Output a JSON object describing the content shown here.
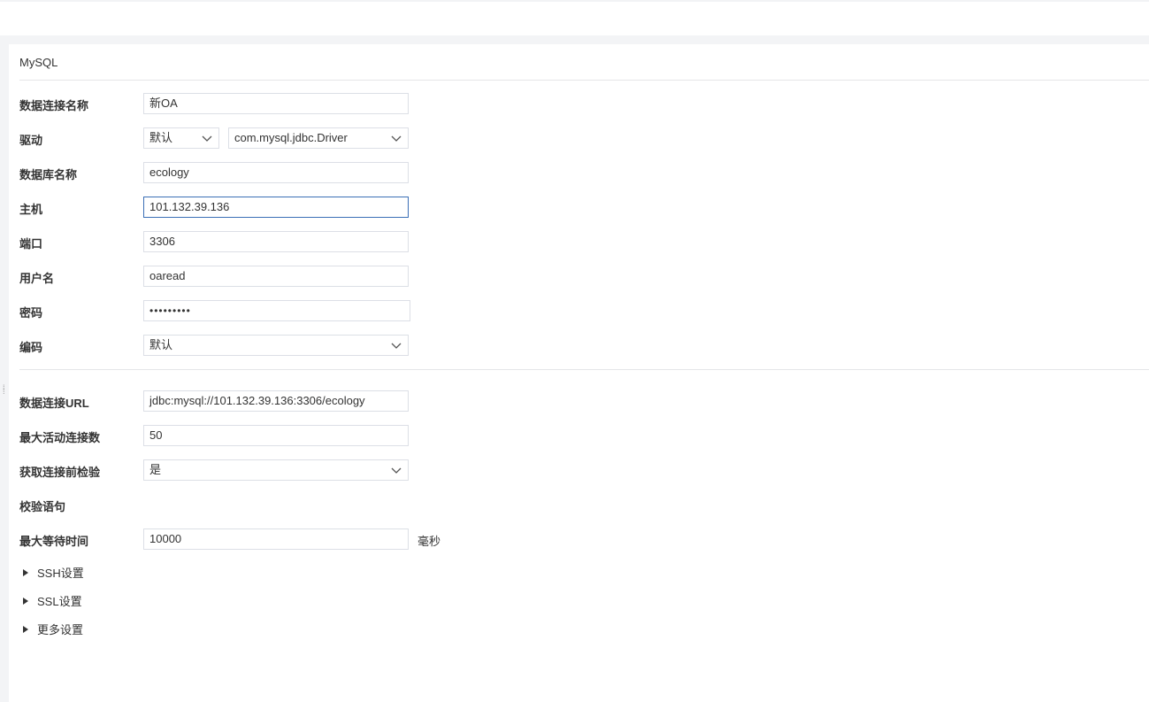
{
  "panel": {
    "title": "MySQL"
  },
  "form": {
    "conn_name": {
      "label": "数据连接名称",
      "value": "新OA"
    },
    "driver": {
      "label": "驱动",
      "mode": "默认",
      "class": "com.mysql.jdbc.Driver"
    },
    "db_name": {
      "label": "数据库名称",
      "value": "ecology"
    },
    "host": {
      "label": "主机",
      "value": "101.132.39.136"
    },
    "port": {
      "label": "端口",
      "value": "3306"
    },
    "username": {
      "label": "用户名",
      "value": "oaread"
    },
    "password": {
      "label": "密码",
      "value": "•••••••••"
    },
    "encoding": {
      "label": "编码",
      "value": "默认"
    },
    "url": {
      "label": "数据连接URL",
      "value": "jdbc:mysql://101.132.39.136:3306/ecology"
    },
    "max_active": {
      "label": "最大活动连接数",
      "value": "50"
    },
    "test_on_borrow": {
      "label": "获取连接前检验",
      "value": "是"
    },
    "validation_query": {
      "label": "校验语句"
    },
    "max_wait": {
      "label": "最大等待时间",
      "value": "10000",
      "unit": "毫秒"
    }
  },
  "sections": {
    "ssh": "SSH设置",
    "ssl": "SSL设置",
    "more": "更多设置"
  },
  "icons": {
    "dropdown": "chevron-down-icon",
    "expand": "caret-right-icon",
    "handle": "drag-handle-icon"
  }
}
